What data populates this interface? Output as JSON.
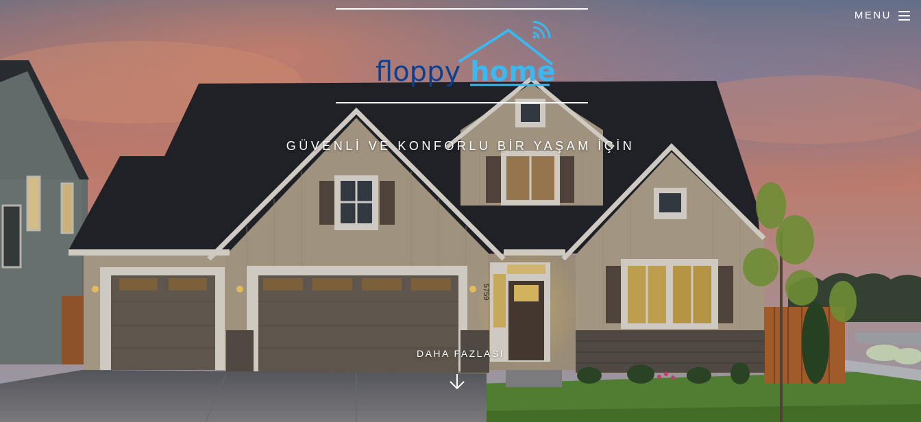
{
  "header": {
    "menu_label": "MENU",
    "menu_icon": "hamburger-icon"
  },
  "logo": {
    "word1": "floppy",
    "word2": "home",
    "icon": "house-wifi-icon",
    "colors": {
      "word1": "#0d3f8f",
      "word2": "#3db7ee"
    }
  },
  "hero": {
    "tagline": "GÜVENLİ VE KONFORLU BİR YAŞAM İÇİN",
    "more_label": "DAHA FAZLASI",
    "more_icon": "arrow-down-icon",
    "house_number": "5759"
  },
  "colors": {
    "sky_top": "#6f7d98",
    "sky_pink": "#d98a7e",
    "roof": "#24262c",
    "siding": "#b9ab96",
    "trim": "#ece6dc",
    "garage": "#6b6157",
    "lawn": "#5d8f3a"
  }
}
